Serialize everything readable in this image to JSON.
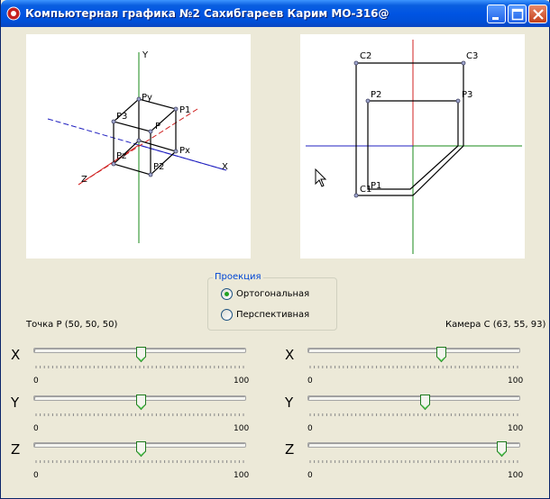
{
  "window": {
    "title": "Компьютерная графика №2 Сахибгареев Карим МО-316@"
  },
  "left_view": {
    "labels": {
      "y": "Y",
      "x": "X",
      "z": "Z",
      "p1": "P1",
      "p2": "P2",
      "p3": "P3",
      "px": "Px",
      "py": "Py",
      "pz": "Pz",
      "p": "P"
    }
  },
  "right_view": {
    "labels": {
      "c1": "C1",
      "c2": "C2",
      "c3": "C3",
      "p1": "P1",
      "p2": "P2",
      "p3": "P3"
    }
  },
  "projection": {
    "legend": "Проекция",
    "options": [
      {
        "label": "Ортогональная",
        "checked": true
      },
      {
        "label": "Перспективная",
        "checked": false
      }
    ]
  },
  "point_p": {
    "caption": "Точка P (50, 50, 50)",
    "sliders": [
      {
        "axis": "X",
        "value": 50,
        "min": "0",
        "max": "100"
      },
      {
        "axis": "Y",
        "value": 50,
        "min": "0",
        "max": "100"
      },
      {
        "axis": "Z",
        "value": 50,
        "min": "0",
        "max": "100"
      }
    ]
  },
  "camera_c": {
    "caption": "Камера С (63, 55, 93)",
    "sliders": [
      {
        "axis": "X",
        "value": 63,
        "min": "0",
        "max": "100"
      },
      {
        "axis": "Y",
        "value": 55,
        "min": "0",
        "max": "100"
      },
      {
        "axis": "Z",
        "value": 93,
        "min": "0",
        "max": "100"
      }
    ]
  }
}
